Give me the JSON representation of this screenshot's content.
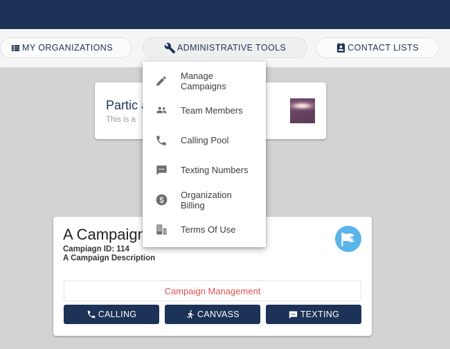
{
  "header": {
    "bar_color": "#1c3257"
  },
  "nav": {
    "items": [
      {
        "id": "my-organizations",
        "label": "MY ORGANIZATIONS",
        "icon": "view-list-icon",
        "active": false
      },
      {
        "id": "administrative-tools",
        "label": "ADMINISTRATIVE TOOLS",
        "icon": "wrench-icon",
        "active": true
      },
      {
        "id": "contact-lists",
        "label": "CONTACT LISTS",
        "icon": "contact-page-icon",
        "active": false
      }
    ]
  },
  "admin_menu": {
    "open": true,
    "items": [
      {
        "label": "Manage Campaigns",
        "icon": "pencil-icon"
      },
      {
        "label": "Team Members",
        "icon": "people-icon"
      },
      {
        "label": "Calling Pool",
        "icon": "phone-icon"
      },
      {
        "label": "Texting Numbers",
        "icon": "chat-bubble-icon"
      },
      {
        "label": "Organization Billing",
        "icon": "dollar-coin-icon"
      },
      {
        "label": "Terms Of Use",
        "icon": "building-icon"
      }
    ]
  },
  "top_card": {
    "title": "Partic                    age",
    "subtitle": "This is a",
    "thumbnail": "landscape-photo-thumbnail"
  },
  "campaign_card": {
    "title": "A Campaign",
    "campaign_id": "Campiagn ID: 114",
    "description": "A Campaign Description",
    "avatar_icon": "campaign-flag-icon",
    "avatar_color": "#5ab4e8",
    "manage_label": "Campaign Management",
    "manage_color": "#d9534f",
    "actions": [
      {
        "label": "CALLING",
        "icon": "phone-icon"
      },
      {
        "label": "CANVASS",
        "icon": "walking-person-icon"
      },
      {
        "label": "TEXTING",
        "icon": "chat-bubble-icon"
      }
    ]
  }
}
